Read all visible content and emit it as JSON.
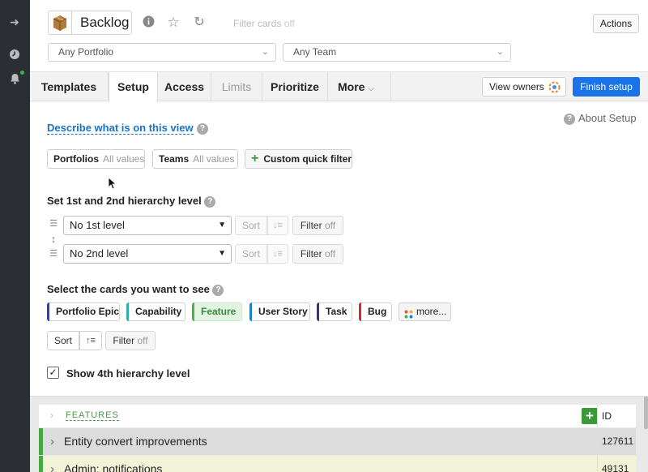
{
  "header": {
    "title": "Backlog",
    "filter_label": "Filter cards",
    "filter_state": "off",
    "actions_label": "Actions",
    "portfolio_select": "Any Portfolio",
    "team_select": "Any Team"
  },
  "tabs": [
    {
      "label": "Templates"
    },
    {
      "label": "Setup"
    },
    {
      "label": "Access"
    },
    {
      "label": "Limits"
    },
    {
      "label": "Prioritize"
    },
    {
      "label": "More"
    }
  ],
  "toolbar": {
    "view_owners": "View owners",
    "finish_setup": "Finish setup"
  },
  "setup": {
    "describe_link": "Describe what is on this view",
    "about_setup": "About Setup",
    "quick_filters": {
      "portfolios_label": "Portfolios",
      "portfolios_value": "All values",
      "teams_label": "Teams",
      "teams_value": "All values",
      "custom_label": "Custom quick filter"
    },
    "hierarchy_heading": "Set 1st and 2nd hierarchy level",
    "level1": "No 1st level",
    "level2": "No 2nd level",
    "sort_label": "Sort",
    "filter_label": "Filter",
    "off_label": "off",
    "cards_heading": "Select the cards you want to see",
    "card_types": [
      {
        "label": "Portfolio Epic",
        "color": "#3a3f8f"
      },
      {
        "label": "Capability",
        "color": "#2ab5a8"
      },
      {
        "label": "Feature",
        "color": "#4caf50"
      },
      {
        "label": "User Story",
        "color": "#1f7fd6"
      },
      {
        "label": "Task",
        "color": "#2b3b7a"
      },
      {
        "label": "Bug",
        "color": "#c62c3a"
      },
      {
        "label": "more..."
      }
    ],
    "show_4th": "Show 4th hierarchy level"
  },
  "board": {
    "group_label": "FEATURES",
    "id_header": "ID",
    "rows": [
      {
        "title": "Entity convert improvements",
        "id": "127611"
      },
      {
        "title": "Admin: notifications",
        "id": "49131"
      }
    ]
  }
}
